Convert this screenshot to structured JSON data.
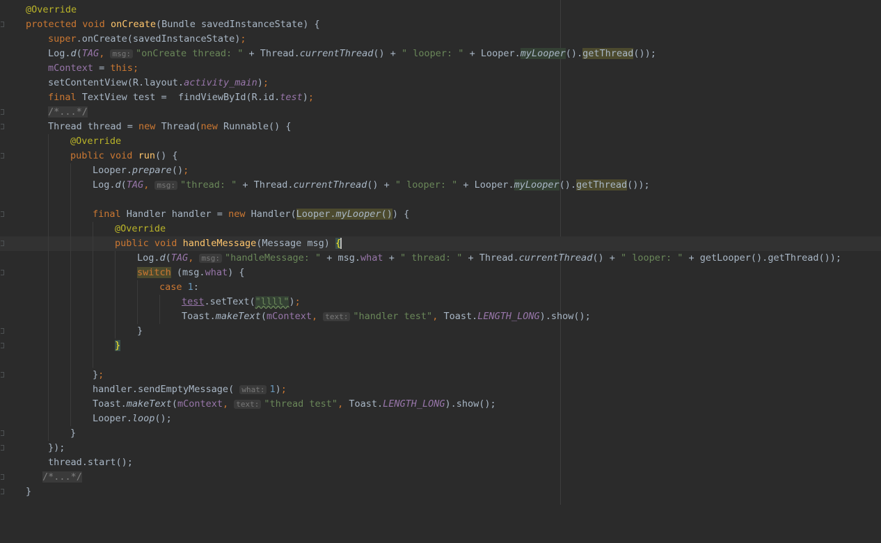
{
  "editor": {
    "language": "java",
    "colors": {
      "background": "#2b2b2b",
      "keyword": "#cc7832",
      "method_decl": "#ffc66d",
      "annotation": "#bbb529",
      "string": "#6a8759",
      "number": "#6897bb",
      "field": "#9876aa",
      "plain": "#a9b7c6"
    },
    "lines": [
      "@Override",
      "protected void onCreate(Bundle savedInstanceState) {",
      "    super.onCreate(savedInstanceState);",
      "    Log.d(TAG, msg: \"onCreate thread: \" + Thread.currentThread() + \" looper: \" + Looper.myLooper().getThread());",
      "    mContext = this;",
      "    setContentView(R.layout.activity_main);",
      "    final TextView test =  findViewById(R.id.test);",
      "    /*...*/",
      "    Thread thread = new Thread(new Runnable() {",
      "        @Override",
      "        public void run() {",
      "            Looper.prepare();",
      "            Log.d(TAG, msg: \"thread: \" + Thread.currentThread() + \" looper: \" + Looper.myLooper().getThread());",
      "",
      "            final Handler handler = new Handler(Looper.myLooper()) {",
      "                @Override",
      "                public void handleMessage(Message msg) {",
      "                    Log.d(TAG, msg: \"handleMessage: \" + msg.what + \" thread: \" + Thread.currentThread() + \" looper: \" + getLooper().getThread());",
      "                    switch (msg.what) {",
      "                        case 1:",
      "                            test.setText(\"llll\");",
      "                            Toast.makeText(mContext, text: \"handler test\", Toast.LENGTH_LONG).show();",
      "                    }",
      "                }",
      "",
      "            };",
      "            handler.sendEmptyMessage( what: 1);",
      "            Toast.makeText(mContext, text: \"thread test\", Toast.LENGTH_LONG).show();",
      "            Looper.loop();",
      "        }",
      "    });",
      "    thread.start();",
      "    /*...*/",
      "}"
    ],
    "tokens": {
      "override": "@Override",
      "protected": "protected",
      "void": "void",
      "onCreate": "onCreate",
      "bundle_param": "(Bundle savedInstanceState) {",
      "super": "super",
      "super_call": ".onCreate(savedInstanceState)",
      "semi": ";",
      "log": "Log.",
      "d": "d",
      "open_paren": "(",
      "TAG": "TAG",
      "comma": ",",
      "hint_msg": "msg:",
      "hint_text": "text:",
      "hint_what": "what:",
      "str_oncreate_thread": "\"onCreate thread: \"",
      "plus": " + ",
      "thread_cls": "Thread.",
      "currentThread": "currentThread",
      "parens": "()",
      "str_looper": "\" looper: \"",
      "looper_cls": "Looper.",
      "myLooper": "myLooper",
      "dot": ".",
      "getThread": "getThread",
      "close_parens": "());",
      "mContext": "mContext",
      "eq": " = ",
      "this": "this",
      "setContentView": "setContentView(R.layout.",
      "activity_main": "activity_main",
      "close_paren": ")",
      "final": "final",
      "textview_decl": " TextView test =  findViewById(R.id.",
      "test": "test",
      "folded": "/*...*/",
      "thread_decl": "Thread thread = ",
      "new": "new",
      "thread_ctor": " Thread(",
      "runnable": " Runnable() {",
      "public": "public",
      "run": "run",
      "brace_open": "() {",
      "prepare": "prepare",
      "str_thread": "\"thread: \"",
      "handler_decl": " Handler handler = ",
      "handler_ctor": " Handler(",
      "looper_arg_prefix": "Looper.",
      "after_looper_arg": ") {",
      "handleMessage": "handleMessage",
      "message_param": "(Message msg) ",
      "brace": "{",
      "str_handlemessage": "\"handleMessage: \"",
      "msg_dot": "msg.",
      "what": "what",
      "str_thread_sp": "\" thread: \"",
      "getLooper": "getLooper().",
      "switch": "switch",
      "switch_rest_open": " (msg.",
      "switch_rest_close": ") {",
      "case": "case",
      "one": "1",
      "colon": ":",
      "settext": ".setText(",
      "str_llll": "\"llll\"",
      "close_semi": ");",
      "toast": "Toast.",
      "makeText": "makeText",
      "str_handler_test": "\"handler test\"",
      "toast_cls": " Toast.",
      "LENGTH_LONG": "LENGTH_LONG",
      "show": ").show();",
      "close_brace": "}",
      "close_obj": "};",
      "handler_send": "handler.sendEmptyMessage( ",
      "str_thread_test": "\"thread test\"",
      "loop": "loop",
      "call_end": "();",
      "close_runnable": "});",
      "thread_start": "thread.start();"
    }
  }
}
